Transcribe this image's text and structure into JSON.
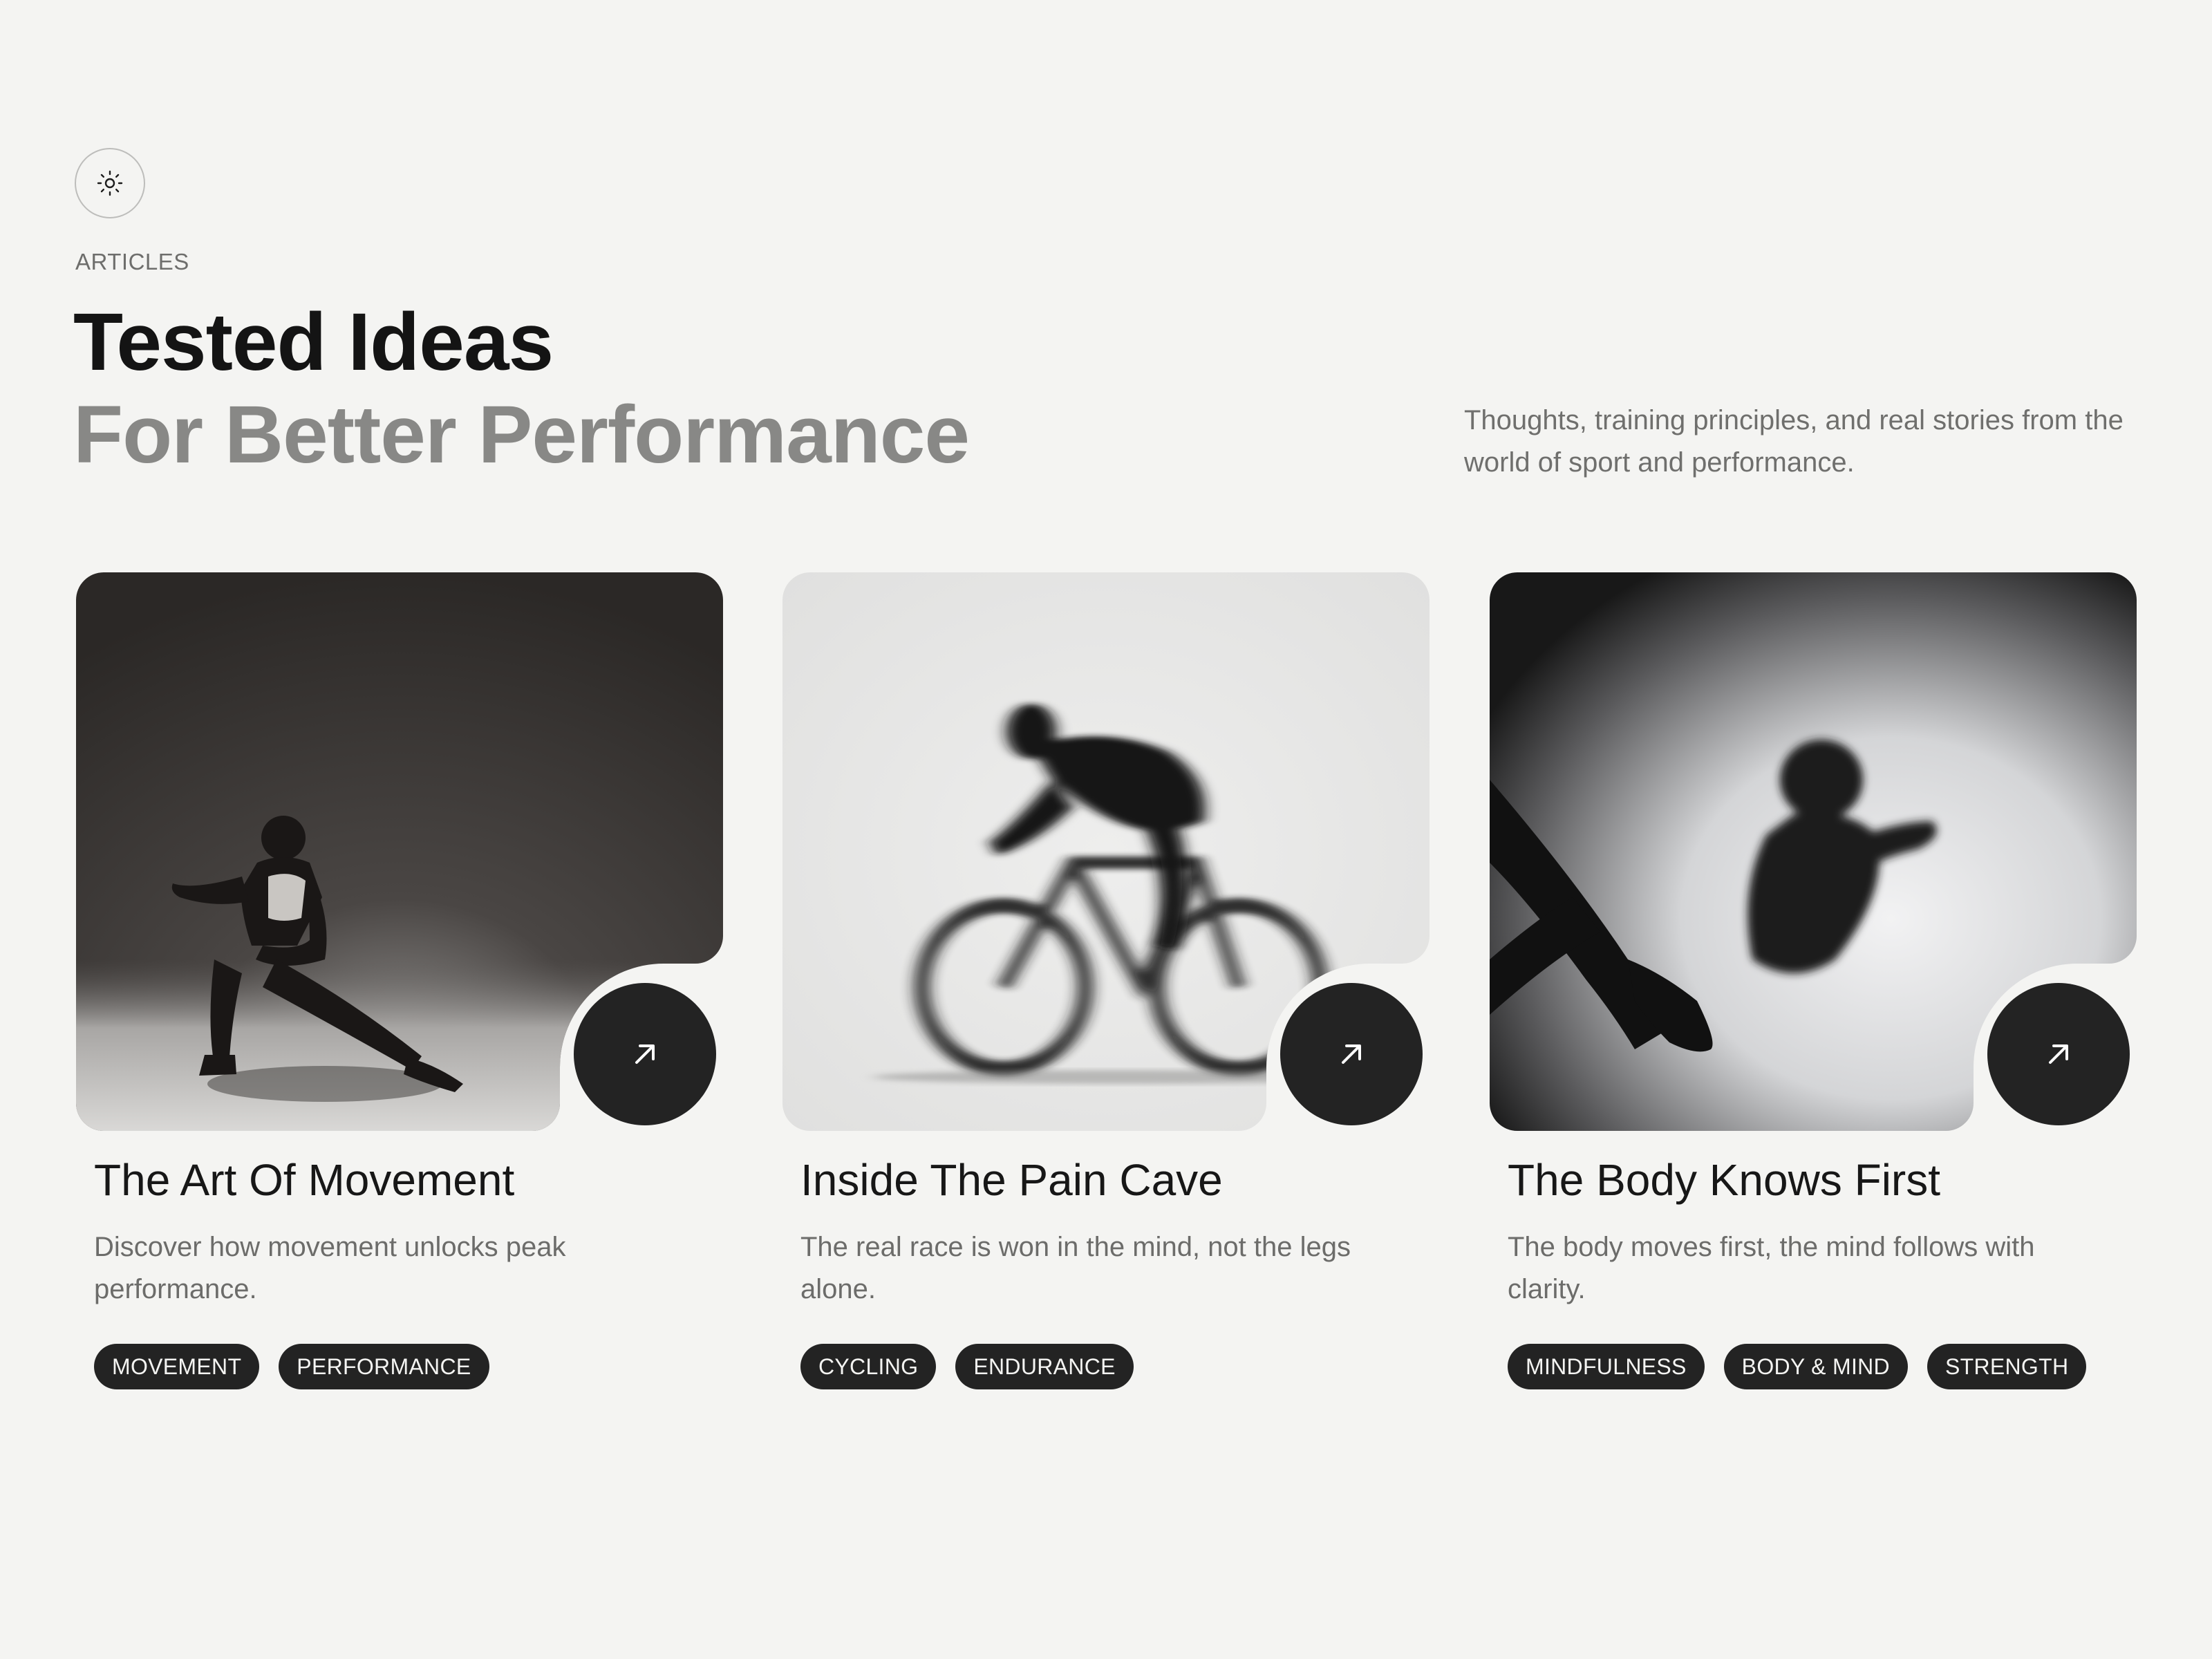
{
  "header": {
    "badge_icon": "sun-icon",
    "eyebrow": "ARTICLES",
    "title_line_1": "Tested Ideas",
    "title_line_2": "For Better Performance",
    "intro": "Thoughts, training principles, and real stories from the world of sport and performance."
  },
  "colors": {
    "background": "#f4f4f2",
    "dark": "#232323",
    "muted_title": "#888886",
    "body_text": "#6c6c6a"
  },
  "articles": [
    {
      "title": "The Art Of Movement",
      "description": "Discover how movement unlocks peak performance.",
      "tags": [
        "MOVEMENT",
        "PERFORMANCE"
      ],
      "action_icon": "arrow-up-right-icon"
    },
    {
      "title": "Inside The Pain Cave",
      "description": "The real race is won in the mind, not the legs alone.",
      "tags": [
        "CYCLING",
        "ENDURANCE"
      ],
      "action_icon": "arrow-up-right-icon"
    },
    {
      "title": "The Body Knows First",
      "description": "The body moves first, the mind follows with clarity.",
      "tags": [
        "MINDFULNESS",
        "BODY & MIND",
        "STRENGTH"
      ],
      "action_icon": "arrow-up-right-icon"
    }
  ]
}
